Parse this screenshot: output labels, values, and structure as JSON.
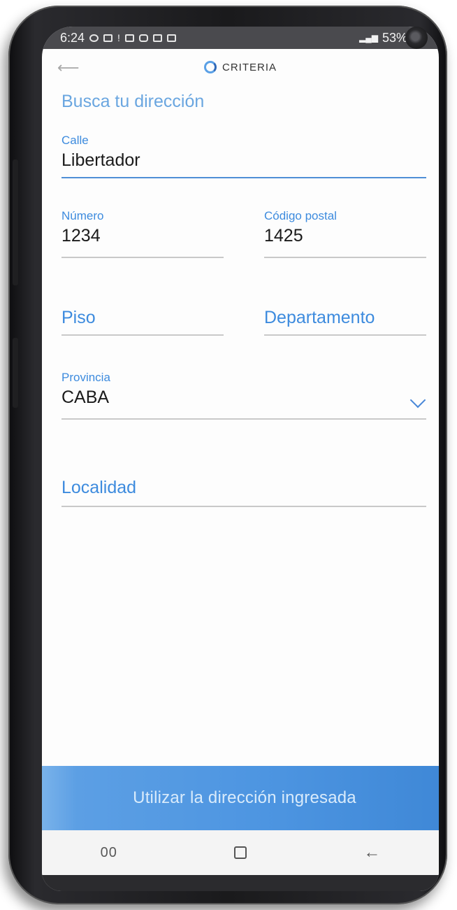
{
  "status_bar": {
    "time": "6:24",
    "battery": "53%",
    "icons": [
      "whatsapp-icon",
      "mail-icon",
      "notification-icon",
      "gmail-icon",
      "instagram-icon",
      "gallery-icon",
      "gmail-icon"
    ],
    "signal": "wifi-signal-icon"
  },
  "header": {
    "logo_text": "CRITERIA",
    "back_icon": "back-arrow-icon"
  },
  "form": {
    "title": "Busca tu dirección",
    "calle": {
      "label": "Calle",
      "value": "Libertador"
    },
    "numero": {
      "label": "Número",
      "value": "1234"
    },
    "codigo_postal": {
      "label": "Código postal",
      "value": "1425"
    },
    "piso": {
      "placeholder": "Piso"
    },
    "departamento": {
      "placeholder": "Departamento"
    },
    "provincia": {
      "label": "Provincia",
      "value": "CABA"
    },
    "localidad": {
      "placeholder": "Localidad"
    }
  },
  "cta": {
    "label": "Utilizar la dirección ingresada"
  },
  "nav": {
    "recent_label": "00",
    "back_label": "←"
  },
  "colors": {
    "accent": "#3d8bde",
    "cta": "#4d95e1",
    "status_bar": "#4a4a4e"
  }
}
